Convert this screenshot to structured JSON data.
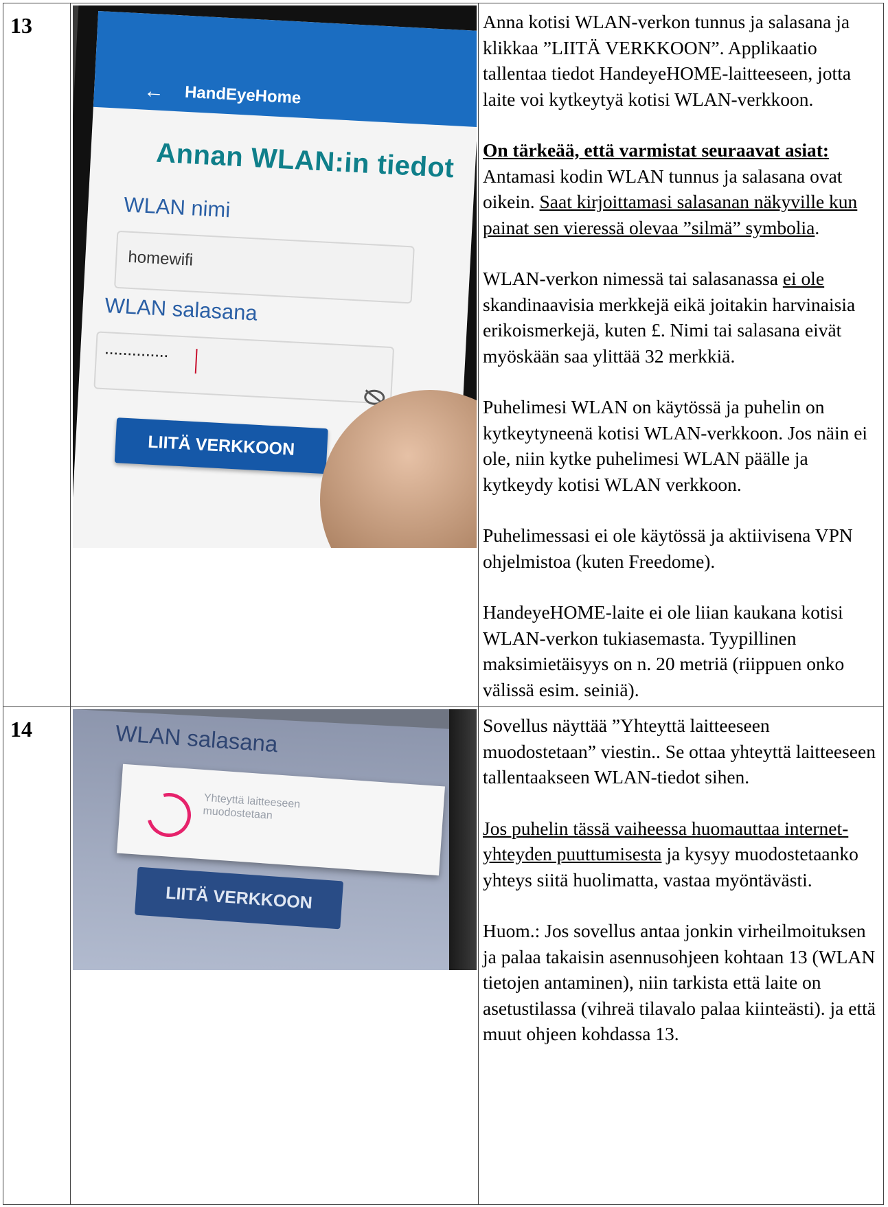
{
  "steps": [
    {
      "number": "13",
      "photo": {
        "app_title": "HandEyeHome",
        "heading": "Annan WLAN:in tiedot",
        "name_label": "WLAN nimi",
        "name_value": "homewifi",
        "password_label": "WLAN salasana",
        "password_value": "··············",
        "connect_button": "LIITÄ VERKKOON"
      },
      "intro": "Anna kotisi WLAN-verkon tunnus ja salasana ja klikkaa ”LIITÄ VERKKOON”. Applikaatio tallentaa tiedot HandeyeHOME-laitteeseen, jotta laite voi kytkeytyä kotisi WLAN-verkkoon.",
      "important_heading": "On tärkeää, että varmistat seuraavat asiat:",
      "check1_a": "Antamasi kodin WLAN tunnus ja salasana ovat oikein. ",
      "check1_b": "Saat kirjoittamasi salasanan näkyville kun painat sen vieressä olevaa ”silmä” symbolia",
      "check1_c": ".",
      "check2_a": "WLAN-verkon nimessä tai salasanassa ",
      "check2_b": "ei ole",
      "check2_c": " skandinaavisia merkkejä eikä joitakin harvinaisia erikoismerkejä, kuten £. Nimi tai salasana eivät myöskään saa ylittää 32 merkkiä.",
      "check3": "Puhelimesi WLAN on käytössä ja puhelin on kytkeytyneenä kotisi WLAN-verkkoon. Jos näin ei ole, niin kytke puhelimesi WLAN päälle ja kytkeydy kotisi WLAN verkkoon.",
      "check4": "Puhelimessasi ei ole käytössä ja aktiivisena VPN ohjelmistoa (kuten Freedome).",
      "check5": "HandeyeHOME-laite ei ole liian kaukana kotisi WLAN-verkon tukiasemasta. Tyypillinen maksimietäisyys on n. 20 metriä (riippuen onko välissä esim. seiniä)."
    },
    {
      "number": "14",
      "photo": {
        "password_label": "WLAN salasana",
        "dialog_text": "Yhteyttä laitteeseen muodostetaan",
        "connect_button": "LIITÄ VERKKOON"
      },
      "intro": "Sovellus näyttää ”Yhteyttä laitteeseen muodostetaan” viestin.. Se ottaa yhteyttä laitteeseen tallentaakseen WLAN-tiedot sihen.",
      "warn_a": "Jos puhelin tässä vaiheessa huomauttaa internet-yhteyden puuttumisesta",
      "warn_b": " ja kysyy muodostetaanko yhteys siitä huolimatta, vastaa myöntävästi.",
      "note": "Huom.: Jos sovellus antaa jonkin virheilmoituksen ja palaa takaisin asennusohjeen kohtaan 13 (WLAN tietojen antaminen), niin tarkista että laite on asetustilassa (vihreä tilavalo palaa kiinteästi). ja että muut ohjeen kohdassa 13."
    }
  ]
}
